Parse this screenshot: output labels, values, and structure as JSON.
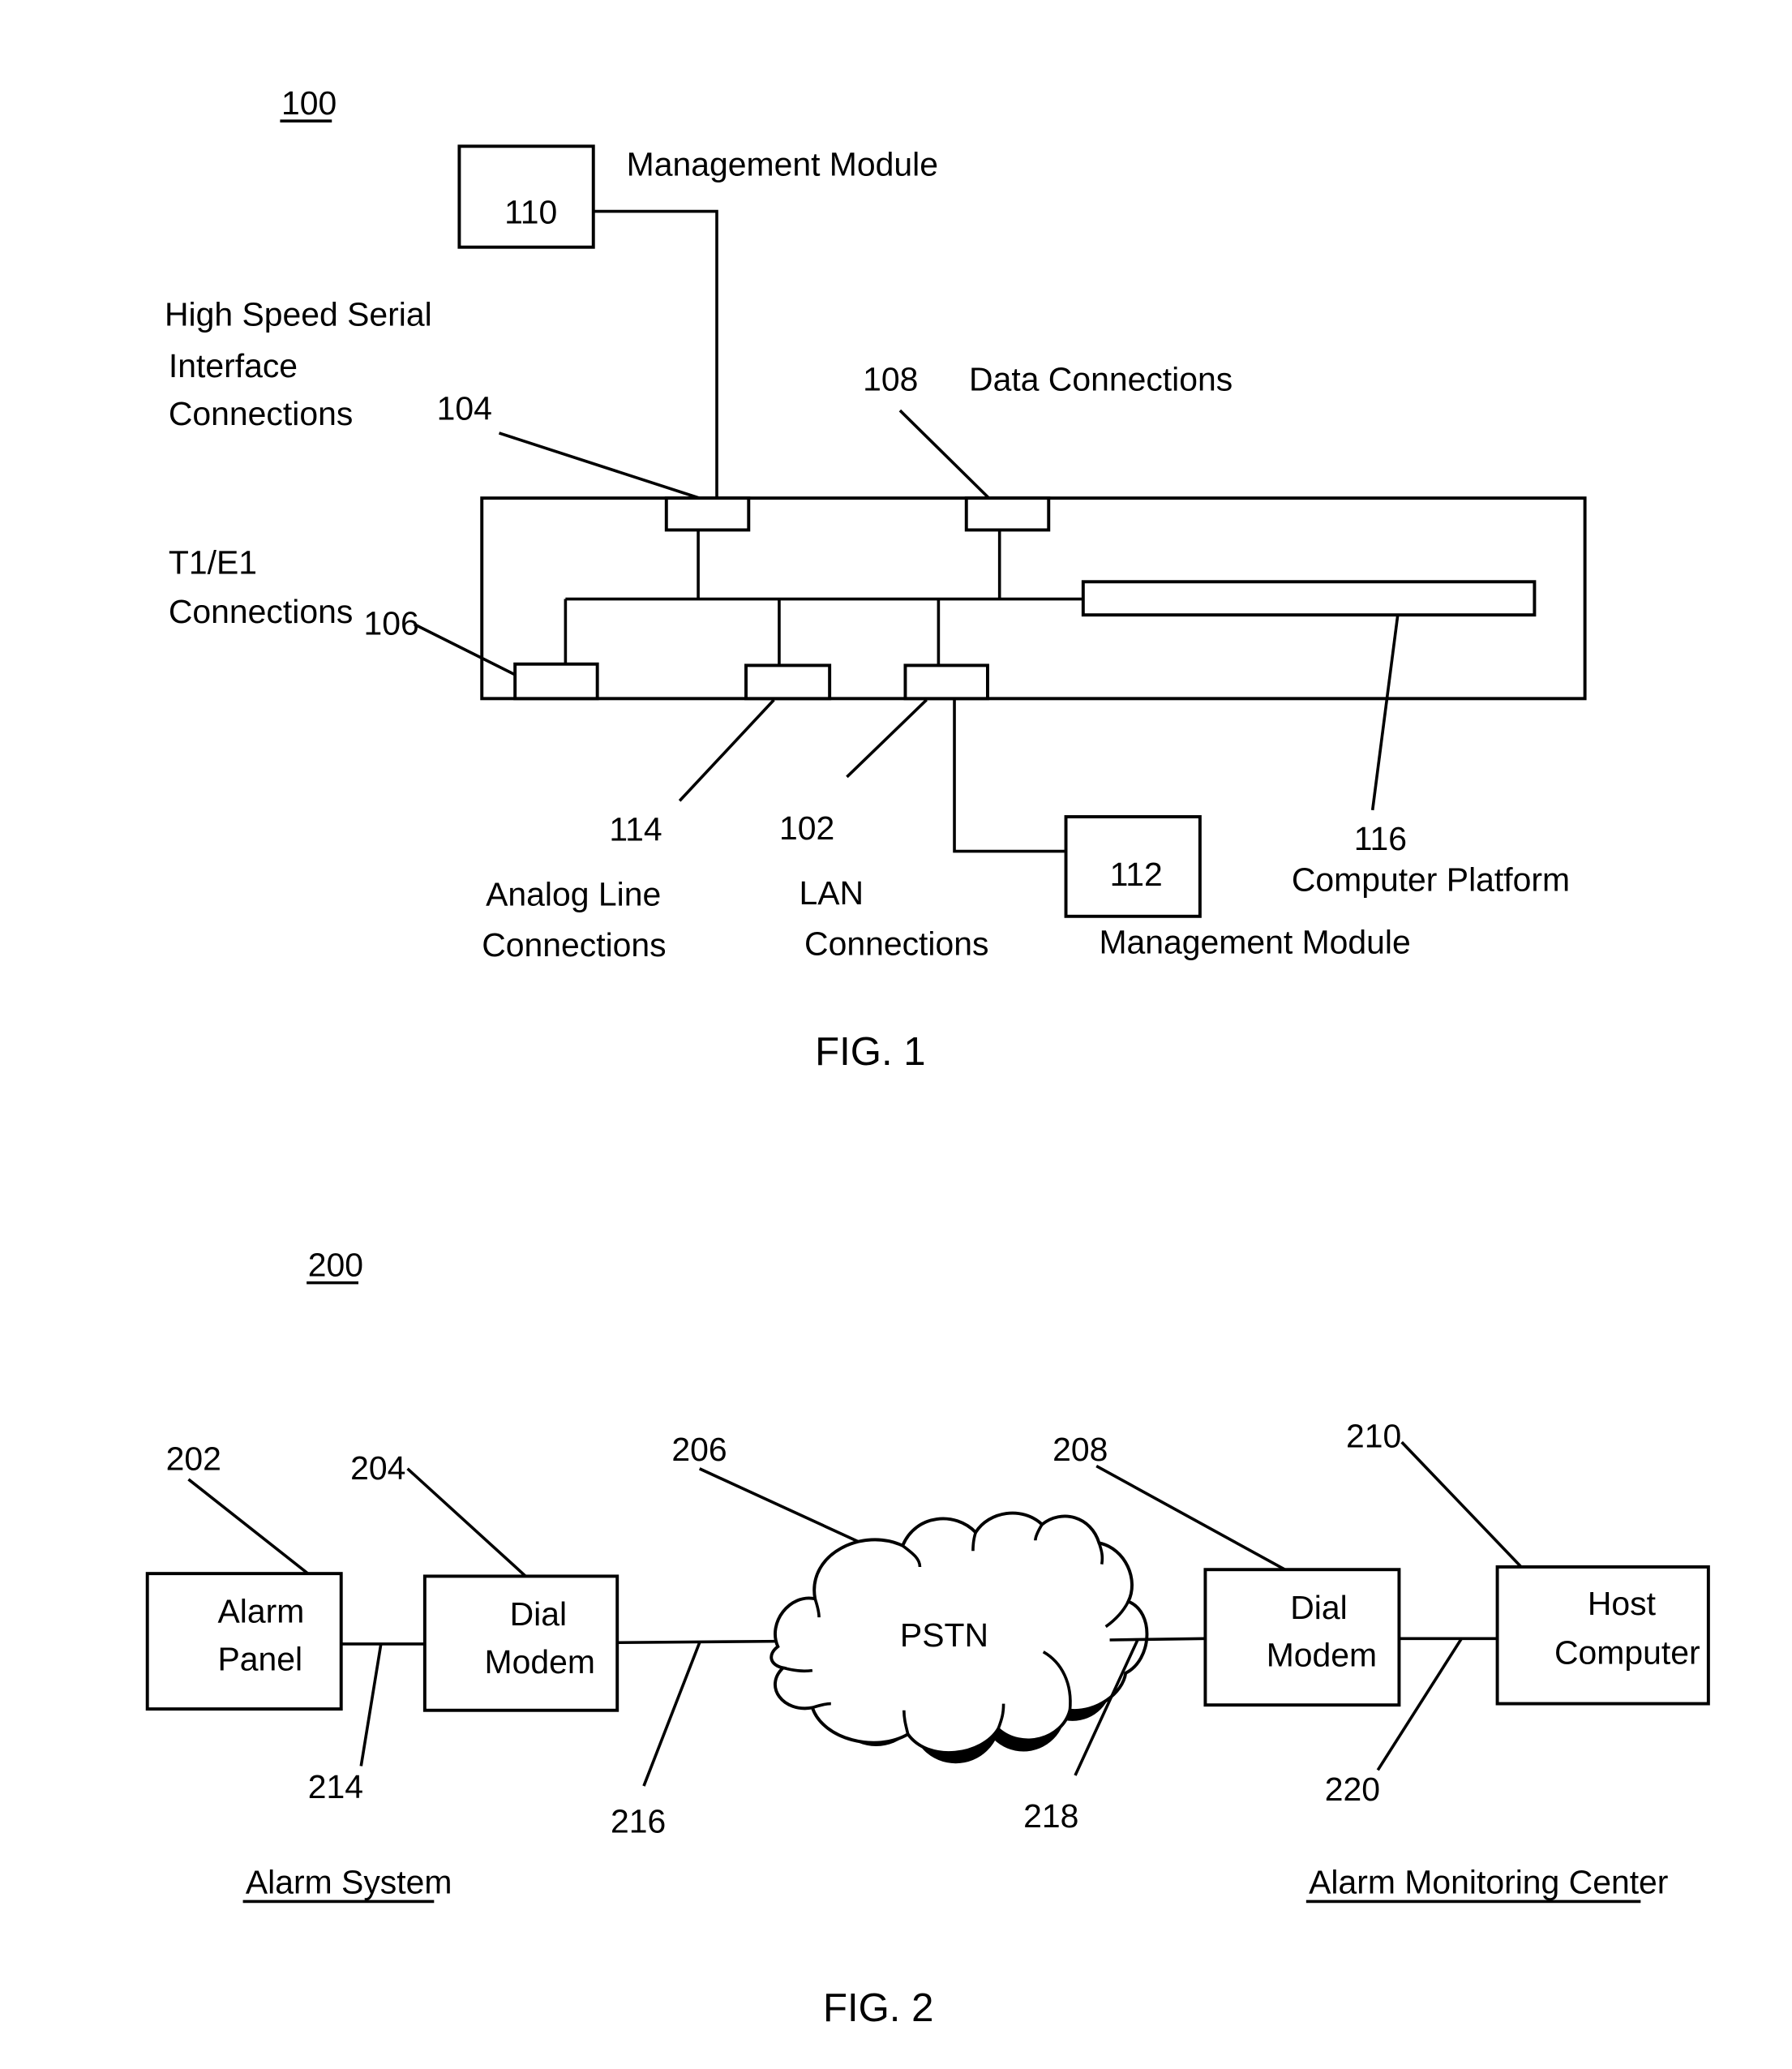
{
  "fig1": {
    "ref": "100",
    "caption": "FIG. 1",
    "management_module_top": {
      "number": "110",
      "label": "Management Module"
    },
    "management_module_bottom": {
      "number": "112",
      "label": "Management Module"
    },
    "hssi": {
      "number": "104",
      "label_lines": [
        "High Speed Serial",
        "Interface",
        "Connections"
      ]
    },
    "t1e1": {
      "number": "106",
      "label_lines": [
        "T1/E1",
        "Connections"
      ]
    },
    "data": {
      "number": "108",
      "label": "Data Connections"
    },
    "analog": {
      "number": "114",
      "label_lines": [
        "Analog Line",
        "Connections"
      ]
    },
    "lan": {
      "number": "102",
      "label_lines": [
        "LAN",
        "Connections"
      ]
    },
    "platform": {
      "number": "116",
      "label": "Computer Platform"
    }
  },
  "fig2": {
    "ref": "200",
    "caption": "FIG. 2",
    "alarm_panel": {
      "number": "202",
      "label_lines": [
        "Alarm",
        "Panel"
      ]
    },
    "dial_modem_left": {
      "number": "204",
      "label_lines": [
        "Dial",
        "Modem"
      ]
    },
    "pstn": {
      "number": "206",
      "label": "PSTN"
    },
    "dial_modem_right": {
      "number": "208",
      "label_lines": [
        "Dial",
        "Modem"
      ]
    },
    "host_computer": {
      "number": "210",
      "label_lines": [
        "Host",
        "Computer"
      ]
    },
    "link_214": "214",
    "link_216": "216",
    "link_218": "218",
    "link_220": "220",
    "group_left": "Alarm System",
    "group_right": "Alarm Monitoring Center"
  }
}
